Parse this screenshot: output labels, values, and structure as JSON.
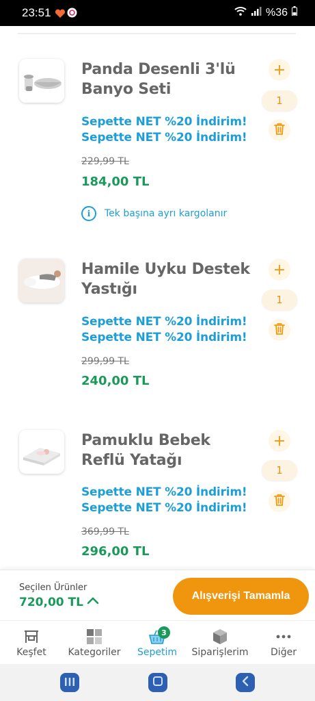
{
  "status_bar": {
    "time": "23:51",
    "battery": "%36"
  },
  "cart": {
    "items": [
      {
        "title": "Panda Desenli 3'lü Banyo Seti",
        "promo_lines": [
          "Sepette NET %20 İndirim!",
          "Sepette NET %20 İndirim!"
        ],
        "old_price": "229,99 TL",
        "price": "184,00 TL",
        "note": "Tek başına ayrı kargolanır",
        "quantity": "1",
        "image": "bath-set-image"
      },
      {
        "title": "Hamile Uyku Destek Yastığı",
        "promo_lines": [
          "Sepette NET %20 İndirim!",
          "Sepette NET %20 İndirim!"
        ],
        "old_price": "299,99 TL",
        "price": "240,00 TL",
        "quantity": "1",
        "image": "pregnancy-pillow-image"
      },
      {
        "title": "Pamuklu Bebek Reflü Yatağı",
        "promo_lines": [
          "Sepette NET %20 İndirim!",
          "Sepette NET %20 İndirim!"
        ],
        "old_price": "369,99 TL",
        "price": "296,00 TL",
        "quantity": "1",
        "image": "reflux-bed-image"
      }
    ]
  },
  "summary": {
    "label": "Seçilen Ürünler",
    "total": "720,00 TL",
    "checkout_label": "Alışverişi Tamamla"
  },
  "tabs": [
    {
      "label": "Keşfet",
      "icon": "discover-icon"
    },
    {
      "label": "Kategoriler",
      "icon": "categories-icon"
    },
    {
      "label": "Sepetim",
      "icon": "basket-icon",
      "badge": "3",
      "active": true
    },
    {
      "label": "Siparişlerim",
      "icon": "orders-box-icon"
    },
    {
      "label": "Diğer",
      "icon": "more-dots-icon"
    }
  ],
  "colors": {
    "accent_orange": "#f0960e",
    "price_green": "#1a9a5a",
    "promo_blue": "#1e9ed6"
  }
}
